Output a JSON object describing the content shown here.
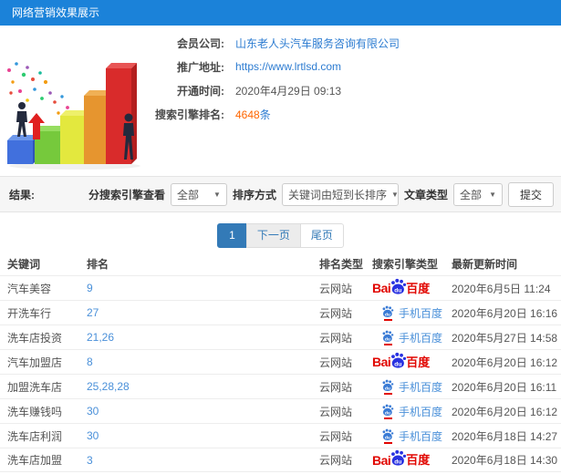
{
  "header": {
    "title": "网络营销效果展示"
  },
  "info": {
    "rows": [
      {
        "label": "会员公司:",
        "value": "山东老人头汽车服务咨询有限公司"
      },
      {
        "label": "推广地址:",
        "value": "https://www.lrtlsd.com"
      },
      {
        "label": "开通时间:",
        "value": "2020年4月29日 09:13"
      },
      {
        "label": "搜索引擎排名:",
        "value": "4648",
        "suffix": "条"
      }
    ]
  },
  "filters": {
    "result_label": "结果:",
    "engine_label": "分搜索引擎查看",
    "engine_value": "全部",
    "sort_label": "排序方式",
    "sort_value": "关键词由短到长排序",
    "article_label": "文章类型",
    "article_value": "全部",
    "submit_label": "提交"
  },
  "pagination": {
    "current": "1",
    "next": "下一页",
    "last": "尾页"
  },
  "table": {
    "headers": [
      "关键词",
      "排名",
      "排名类型",
      "搜索引擎类型",
      "最新更新时间"
    ],
    "rows": [
      {
        "keyword": "汽车美容",
        "rank": "9",
        "rank_type": "云网站",
        "engine": "baidu-pc",
        "time": "2020年6月5日 11:24"
      },
      {
        "keyword": "开洗车行",
        "rank": "27",
        "rank_type": "云网站",
        "engine": "baidu-mobile",
        "time": "2020年6月20日 16:16"
      },
      {
        "keyword": "洗车店投资",
        "rank": "21,26",
        "rank_type": "云网站",
        "engine": "baidu-mobile",
        "time": "2020年5月27日 14:58"
      },
      {
        "keyword": "汽车加盟店",
        "rank": "8",
        "rank_type": "云网站",
        "engine": "baidu-pc",
        "time": "2020年6月20日 16:12"
      },
      {
        "keyword": "加盟洗车店",
        "rank": "25,28,28",
        "rank_type": "云网站",
        "engine": "baidu-mobile",
        "time": "2020年6月20日 16:11"
      },
      {
        "keyword": "洗车赚钱吗",
        "rank": "30",
        "rank_type": "云网站",
        "engine": "baidu-mobile",
        "time": "2020年6月20日 16:12"
      },
      {
        "keyword": "洗车店利润",
        "rank": "30",
        "rank_type": "云网站",
        "engine": "baidu-mobile",
        "time": "2020年6月18日 14:27"
      },
      {
        "keyword": "洗车店加盟",
        "rank": "3",
        "rank_type": "云网站",
        "engine": "baidu-pc",
        "time": "2020年6月18日 14:30"
      }
    ]
  },
  "logos": {
    "baidu_pc": {
      "part1": "Bai",
      "part2": "du",
      "part3": "百度"
    },
    "baidu_mobile": {
      "label": "手机百度"
    }
  },
  "colors": {
    "header_bg": "#1b82d9",
    "link_blue": "#2d7cd1",
    "rank_blue": "#4a90d9",
    "highlight_orange": "#ff6600",
    "baidu_red": "#e10601",
    "baidu_paw_blue": "#2932e1",
    "pagination_active": "#337ab7"
  }
}
